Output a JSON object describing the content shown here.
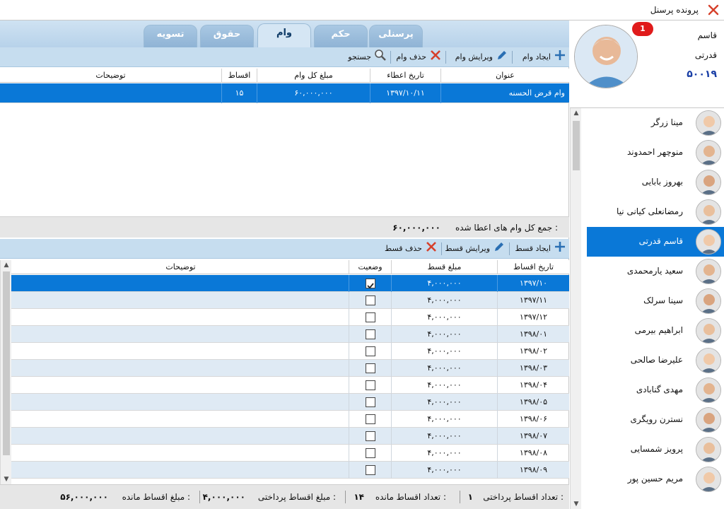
{
  "window": {
    "title": "پرونده پرسنل"
  },
  "tabs": [
    {
      "label": "پرسنلی",
      "active": false
    },
    {
      "label": "حکم",
      "active": false
    },
    {
      "label": "وام",
      "active": true
    },
    {
      "label": "حقوق",
      "active": false
    },
    {
      "label": "تسویه",
      "active": false
    }
  ],
  "loan_toolbar": {
    "create": "ایجاد وام",
    "edit": "ویرایش وام",
    "delete": "حذف وام",
    "search": "جستجو"
  },
  "loan_table": {
    "columns": [
      "عنوان",
      "تاریخ اعطاء",
      "مبلغ کل وام",
      "اقساط",
      "توضیحات"
    ],
    "rows": [
      {
        "title": "وام قرض الحسنه",
        "date": "۱۳۹۷/۱۰/۱۱",
        "amount": "۶۰,۰۰۰,۰۰۰",
        "installments": "۱۵",
        "notes": ""
      }
    ]
  },
  "loan_summary": {
    "label": "جمع کل وام های اعطا شده :",
    "value": "۶۰,۰۰۰,۰۰۰"
  },
  "installment_toolbar": {
    "create": "ایجاد قسط",
    "edit": "ویرایش قسط",
    "delete": "حذف قسط"
  },
  "installment_table": {
    "columns": [
      "تاریخ اقساط",
      "مبلغ قسط",
      "وضعیت",
      "توضیحات"
    ],
    "rows": [
      {
        "date": "۱۳۹۷/۱۰",
        "amount": "۴,۰۰۰,۰۰۰",
        "paid": true
      },
      {
        "date": "۱۳۹۷/۱۱",
        "amount": "۴,۰۰۰,۰۰۰",
        "paid": false
      },
      {
        "date": "۱۳۹۷/۱۲",
        "amount": "۴,۰۰۰,۰۰۰",
        "paid": false
      },
      {
        "date": "۱۳۹۸/۰۱",
        "amount": "۴,۰۰۰,۰۰۰",
        "paid": false
      },
      {
        "date": "۱۳۹۸/۰۲",
        "amount": "۴,۰۰۰,۰۰۰",
        "paid": false
      },
      {
        "date": "۱۳۹۸/۰۳",
        "amount": "۴,۰۰۰,۰۰۰",
        "paid": false
      },
      {
        "date": "۱۳۹۸/۰۴",
        "amount": "۴,۰۰۰,۰۰۰",
        "paid": false
      },
      {
        "date": "۱۳۹۸/۰۵",
        "amount": "۴,۰۰۰,۰۰۰",
        "paid": false
      },
      {
        "date": "۱۳۹۸/۰۶",
        "amount": "۴,۰۰۰,۰۰۰",
        "paid": false
      },
      {
        "date": "۱۳۹۸/۰۷",
        "amount": "۴,۰۰۰,۰۰۰",
        "paid": false
      },
      {
        "date": "۱۳۹۸/۰۸",
        "amount": "۴,۰۰۰,۰۰۰",
        "paid": false
      },
      {
        "date": "۱۳۹۸/۰۹",
        "amount": "۴,۰۰۰,۰۰۰",
        "paid": false
      }
    ]
  },
  "footer": {
    "paid_count_label": "تعداد اقساط پرداختی :",
    "paid_count": "۱",
    "remaining_count_label": "تعداد اقساط مانده :",
    "remaining_count": "۱۴",
    "paid_amount_label": "مبلغ اقساط پرداختی :",
    "paid_amount": "۴,۰۰۰,۰۰۰",
    "remaining_amount_label": "مبلغ اقساط مانده :",
    "remaining_amount": "۵۶,۰۰۰,۰۰۰"
  },
  "profile": {
    "first_name": "قاسم",
    "last_name": "قدرتی",
    "personnel_id": "۵۰۰۱۹",
    "badge": "1"
  },
  "personnel": [
    {
      "name": "مینا زرگر",
      "selected": false
    },
    {
      "name": "منوچهر احمدوند",
      "selected": false
    },
    {
      "name": "بهروز بابایی",
      "selected": false
    },
    {
      "name": "رمضانعلی کیانی نیا",
      "selected": false
    },
    {
      "name": "قاسم قدرتی",
      "selected": true
    },
    {
      "name": "سعید یارمحمدی",
      "selected": false
    },
    {
      "name": "سینا سرلک",
      "selected": false
    },
    {
      "name": "ابراهیم بیرمی",
      "selected": false
    },
    {
      "name": "علیرضا صالحی",
      "selected": false
    },
    {
      "name": "مهدی گنابادی",
      "selected": false
    },
    {
      "name": "نسترن رویگری",
      "selected": false
    },
    {
      "name": "پرویز شمسایی",
      "selected": false
    },
    {
      "name": "مریم حسین پور",
      "selected": false
    }
  ],
  "colors": {
    "accent": "#0a78d7",
    "toolbar": "#c6ddef",
    "badge": "#e01b1b",
    "id_text": "#1a3fa6"
  },
  "icons": {
    "close": "close-icon",
    "add": "plus-icon",
    "edit": "pencil-icon",
    "delete": "x-icon",
    "search": "magnifier-icon",
    "check": "checkmark-icon"
  }
}
